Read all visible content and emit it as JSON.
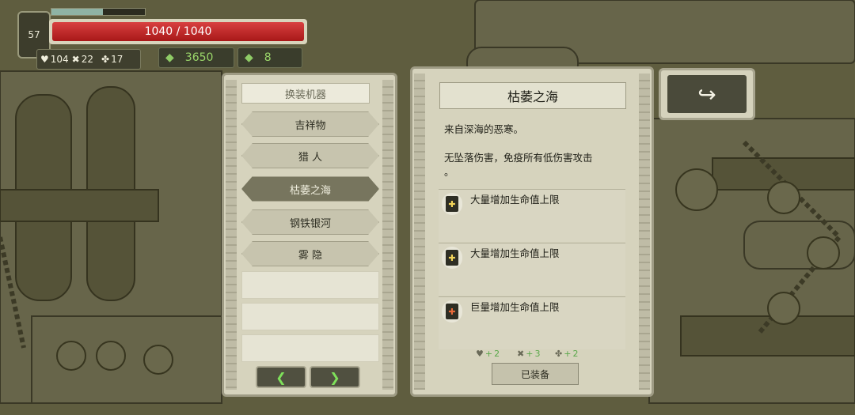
{
  "hud": {
    "level": "57",
    "xp_fraction": 0.55,
    "hp_text": "1040 / 1040",
    "hp_fraction": 1.0,
    "stats": [
      {
        "icon": "heart-icon",
        "glyph": "♥",
        "value": "104"
      },
      {
        "icon": "crossed-swords-icon",
        "glyph": "✖",
        "value": "22"
      },
      {
        "icon": "clover-icon",
        "glyph": "✤",
        "value": "17"
      }
    ],
    "currency": [
      {
        "icon": "green-gem-icon",
        "glyph": "◆",
        "value": "3650"
      },
      {
        "icon": "green-ore-icon",
        "glyph": "◆",
        "value": "8"
      }
    ]
  },
  "left_panel": {
    "title": "换装机器",
    "items": [
      {
        "label": "吉祥物",
        "selected": false
      },
      {
        "label": "猎 人",
        "selected": false
      },
      {
        "label": "枯萎之海",
        "selected": true
      },
      {
        "label": "钢铁银河",
        "selected": false
      },
      {
        "label": "雾 隐",
        "selected": false
      }
    ],
    "prev_glyph": "❮",
    "next_glyph": "❯"
  },
  "right_panel": {
    "title": "枯萎之海",
    "desc1": "来自深海的恶寒。",
    "desc2a": "无坠落伤害，免疫所有低伤害攻击",
    "desc2b": "。",
    "perks": [
      {
        "text": "大量增加生命值上限",
        "icon": "book-icon"
      },
      {
        "text": "大量增加生命值上限",
        "icon": "book-icon"
      },
      {
        "text": "巨量增加生命值上限",
        "icon": "book-icon"
      }
    ],
    "bonuses": [
      {
        "icon": "heart-icon",
        "glyph": "♥",
        "value": "2"
      },
      {
        "icon": "crossed-swords-icon",
        "glyph": "✖",
        "value": "3"
      },
      {
        "icon": "clover-icon",
        "glyph": "✤",
        "value": "2"
      }
    ],
    "equipped_label": "已装备"
  },
  "back_button": {
    "glyph": "↪",
    "icon": "back-arrow-icon"
  },
  "colors": {
    "accent_green": "#7ee05a",
    "hp_red": "#c62a2a",
    "panel": "#d6d3bd"
  }
}
